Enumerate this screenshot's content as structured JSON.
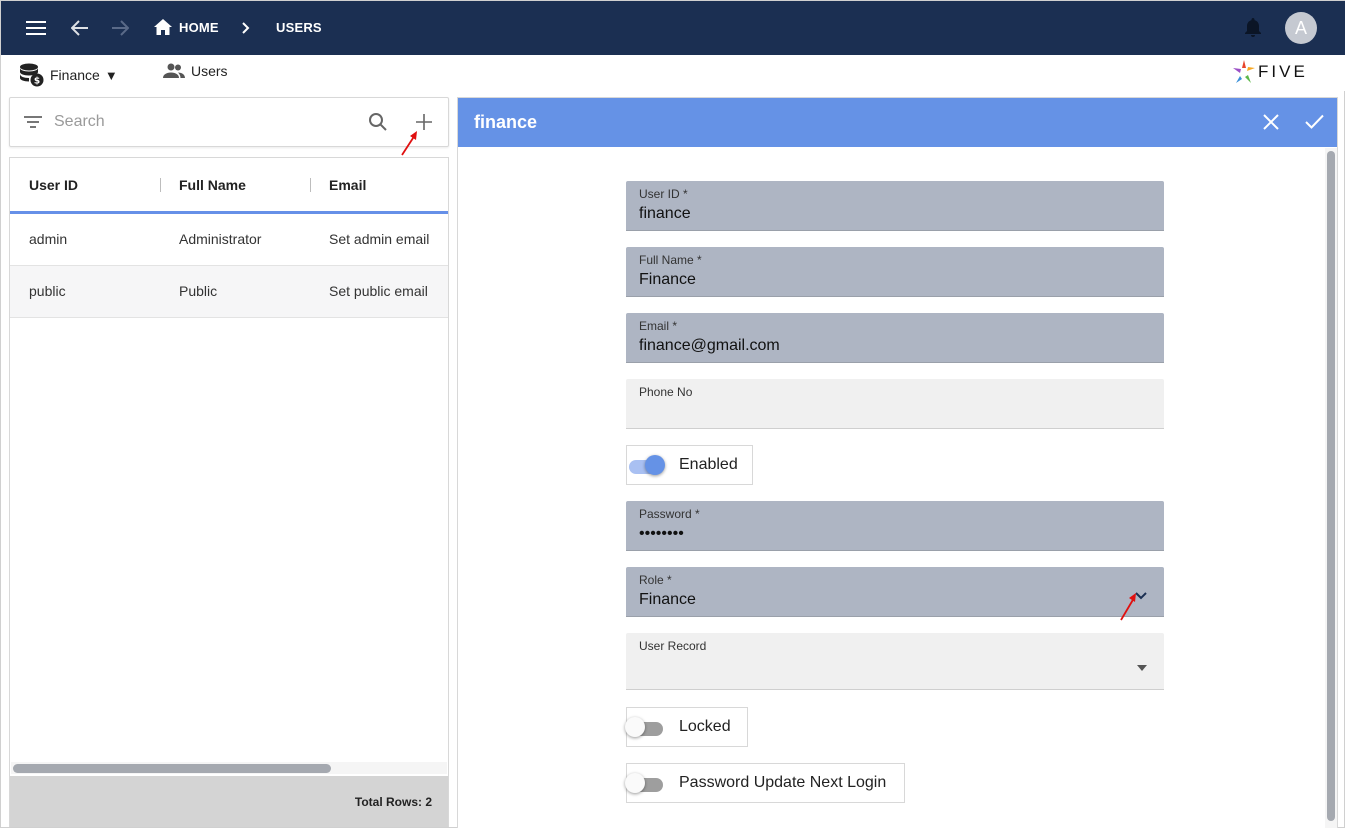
{
  "topbar": {
    "home_label": "HOME",
    "users_label": "USERS",
    "avatar_letter": "A"
  },
  "subbar": {
    "app_menu_label": "Finance",
    "app_menu_caret": "▼",
    "users_menu_label": "Users",
    "brand_text": "FIVE"
  },
  "search": {
    "placeholder": "Search"
  },
  "grid": {
    "columns": [
      "User ID",
      "Full Name",
      "Email"
    ],
    "rows": [
      {
        "user_id": "admin",
        "full_name": "Administrator",
        "email": "Set admin email"
      },
      {
        "user_id": "public",
        "full_name": "Public",
        "email": "Set public email"
      }
    ],
    "total_rows_label": "Total Rows: 2"
  },
  "form": {
    "title": "finance",
    "user_id": {
      "label": "User ID *",
      "value": "finance"
    },
    "full_name": {
      "label": "Full Name *",
      "value": "Finance"
    },
    "email": {
      "label": "Email *",
      "value": "finance@gmail.com"
    },
    "phone": {
      "label": "Phone No",
      "value": ""
    },
    "enabled": {
      "label": "Enabled",
      "on": true
    },
    "password": {
      "label": "Password *",
      "value": "••••••••"
    },
    "role": {
      "label": "Role *",
      "value": "Finance"
    },
    "user_record": {
      "label": "User Record",
      "value": ""
    },
    "locked": {
      "label": "Locked",
      "on": false
    },
    "password_update": {
      "label": "Password Update Next Login",
      "on": false
    }
  },
  "colors": {
    "topbar": "#1b2f52",
    "accent": "#6592e6",
    "field_filled": "#aeb5c3",
    "annotation_arrow": "#e01010"
  }
}
